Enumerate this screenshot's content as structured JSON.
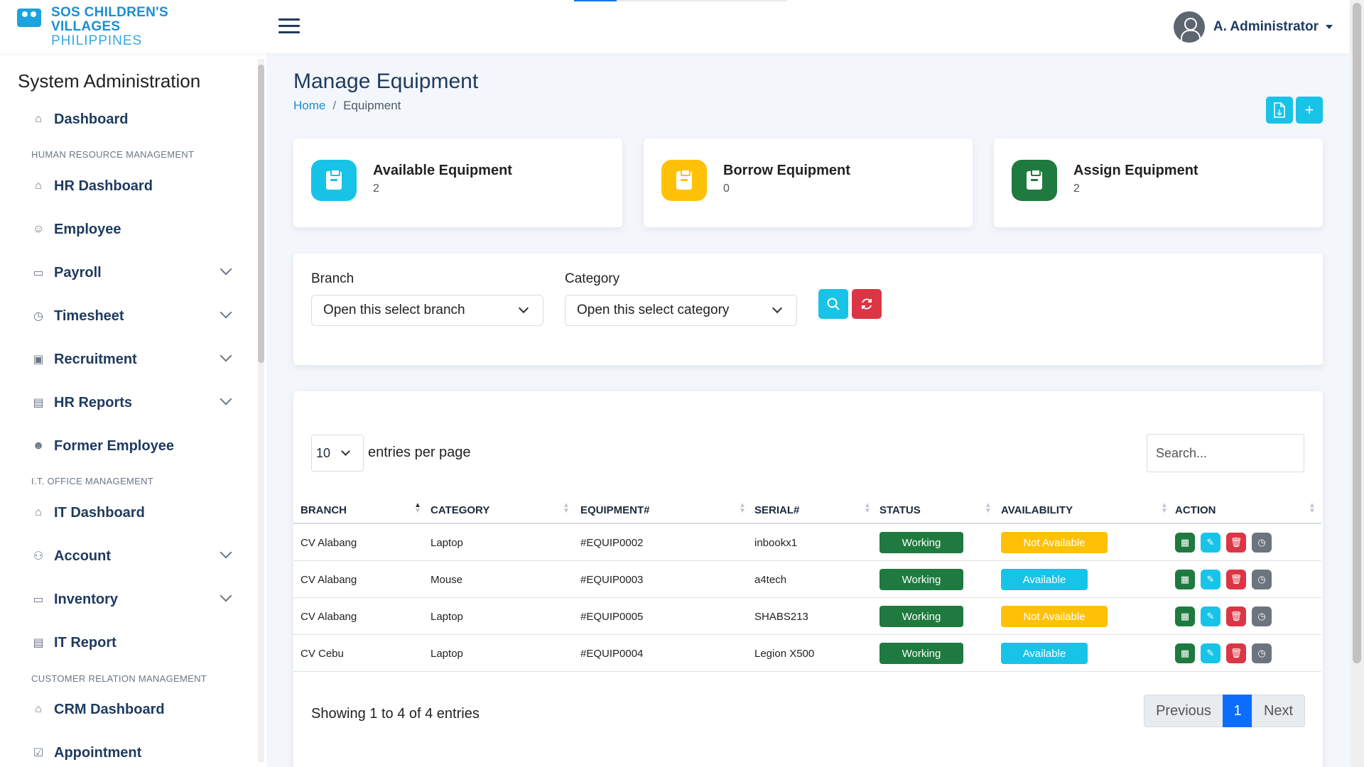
{
  "app": {
    "logo_line1": "SOS CHILDREN'S",
    "logo_line2": "VILLAGES",
    "logo_line3": "PHILIPPINES",
    "user_name": "A. Administrator"
  },
  "sidebar": {
    "title": "System Administration",
    "sections": {
      "hr": "HUMAN RESOURCE MANAGEMENT",
      "it": "I.T. OFFICE MANAGEMENT",
      "crm": "CUSTOMER RELATION MANAGEMENT"
    },
    "items": {
      "dashboard": "Dashboard",
      "hr_dashboard": "HR Dashboard",
      "employee": "Employee",
      "payroll": "Payroll",
      "timesheet": "Timesheet",
      "recruitment": "Recruitment",
      "hr_reports": "HR Reports",
      "former_employee": "Former Employee",
      "it_dashboard": "IT Dashboard",
      "account": "Account",
      "inventory": "Inventory",
      "it_report": "IT Report",
      "crm_dashboard": "CRM Dashboard",
      "appointment": "Appointment"
    }
  },
  "page": {
    "title": "Manage Equipment",
    "breadcrumb": {
      "home": "Home",
      "separator": "/",
      "current": "Equipment"
    },
    "add_label": "+"
  },
  "stats": {
    "available": {
      "title": "Available Equipment",
      "value": "2",
      "color": "#18c3e8"
    },
    "borrow": {
      "title": "Borrow Equipment",
      "value": "0",
      "color": "#ffc107"
    },
    "assign": {
      "title": "Assign Equipment",
      "value": "2",
      "color": "#1e7a3e"
    }
  },
  "filters": {
    "branch_label": "Branch",
    "branch_value": "Open this select branch",
    "category_label": "Category",
    "category_value": "Open this select category"
  },
  "table": {
    "entries_value": "10",
    "entries_label": "entries per page",
    "search_placeholder": "Search...",
    "columns": {
      "branch": "BRANCH",
      "category": "CATEGORY",
      "equipment": "EQUIPMENT#",
      "serial": "SERIAL#",
      "status": "STATUS",
      "availability": "AVAILABILITY",
      "action": "ACTION"
    },
    "rows": [
      {
        "branch": "CV Alabang",
        "category": "Laptop",
        "equipment": "#EQUIP0002",
        "serial": "inbookx1",
        "status": "Working",
        "availability": "Not Available"
      },
      {
        "branch": "CV Alabang",
        "category": "Mouse",
        "equipment": "#EQUIP0003",
        "serial": "a4tech",
        "status": "Working",
        "availability": "Available"
      },
      {
        "branch": "CV Alabang",
        "category": "Laptop",
        "equipment": "#EQUIP0005",
        "serial": "SHABS213",
        "status": "Working",
        "availability": "Not Available"
      },
      {
        "branch": "CV Cebu",
        "category": "Laptop",
        "equipment": "#EQUIP0004",
        "serial": "Legion X500",
        "status": "Working",
        "availability": "Available"
      }
    ],
    "showing": "Showing 1 to 4 of 4 entries",
    "pager": {
      "previous": "Previous",
      "current": "1",
      "next": "Next"
    }
  },
  "colors": {
    "primary": "#18c3e8",
    "danger": "#dc3545",
    "success": "#1e7a3e",
    "warning": "#ffc107",
    "secondary": "#6c757d",
    "active_page": "#0d6efd"
  }
}
